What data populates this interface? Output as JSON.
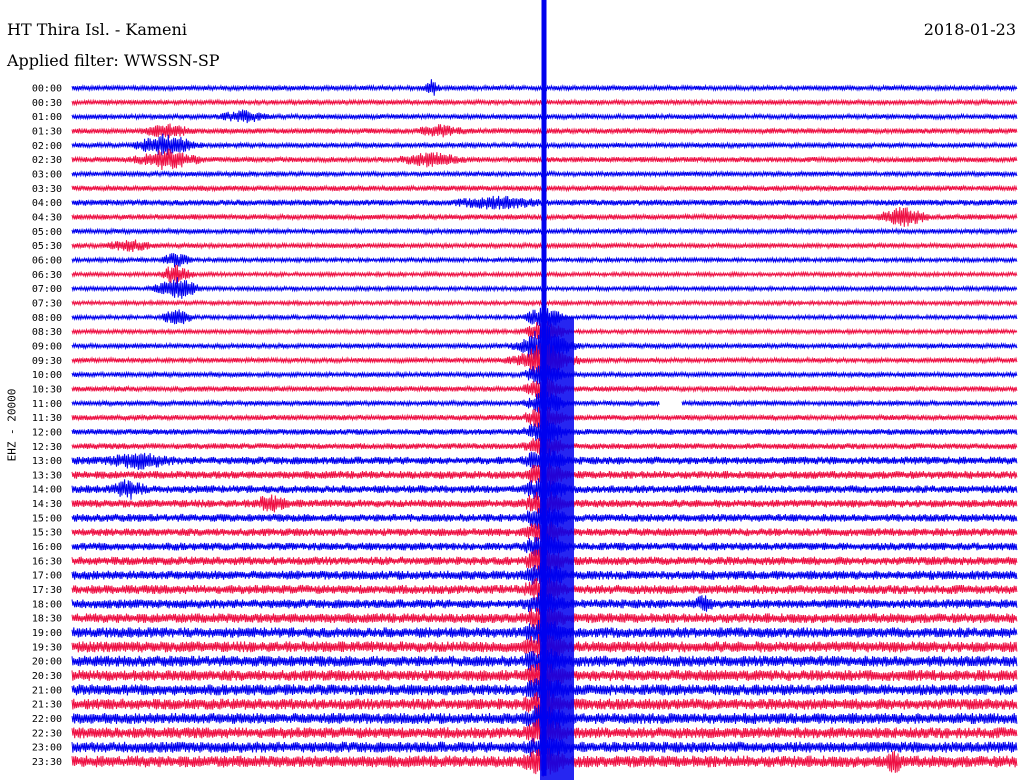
{
  "header": {
    "station": "HT Thira Isl. - Kameni",
    "filter": "Applied filter: WWSSN-SP",
    "date": "2018-01-23",
    "channel": "EHZ - 20000"
  },
  "chart_data": {
    "type": "line",
    "title": "HT Thira Isl. - Kameni",
    "subtitle": "Applied filter: WWSSN-SP",
    "date": "2018-01-23",
    "ylabel": "EHZ - 20000",
    "row_colors": [
      "#0000ee",
      "#ee1144"
    ],
    "rows": [
      {
        "label": "00:00",
        "noise": 0.35,
        "events": [
          {
            "x": 0.38,
            "amp": 1.2,
            "width": 0.01
          }
        ]
      },
      {
        "label": "00:30",
        "noise": 0.35,
        "events": []
      },
      {
        "label": "01:00",
        "noise": 0.35,
        "events": [
          {
            "x": 0.18,
            "amp": 0.8,
            "width": 0.03
          }
        ]
      },
      {
        "label": "01:30",
        "noise": 0.4,
        "events": [
          {
            "x": 0.1,
            "amp": 0.9,
            "width": 0.03
          },
          {
            "x": 0.39,
            "amp": 0.7,
            "width": 0.03
          }
        ]
      },
      {
        "label": "02:00",
        "noise": 0.35,
        "events": [
          {
            "x": 0.1,
            "amp": 1.6,
            "width": 0.04
          }
        ]
      },
      {
        "label": "02:30",
        "noise": 0.4,
        "events": [
          {
            "x": 0.1,
            "amp": 1.4,
            "width": 0.04
          },
          {
            "x": 0.38,
            "amp": 0.9,
            "width": 0.04
          }
        ]
      },
      {
        "label": "03:00",
        "noise": 0.35,
        "events": []
      },
      {
        "label": "03:30",
        "noise": 0.4,
        "events": []
      },
      {
        "label": "04:00",
        "noise": 0.45,
        "events": [
          {
            "x": 0.45,
            "amp": 0.8,
            "width": 0.05
          }
        ]
      },
      {
        "label": "04:30",
        "noise": 0.4,
        "events": [
          {
            "x": 0.88,
            "amp": 1.3,
            "width": 0.03
          }
        ]
      },
      {
        "label": "05:00",
        "noise": 0.35,
        "events": []
      },
      {
        "label": "05:30",
        "noise": 0.35,
        "events": [
          {
            "x": 0.06,
            "amp": 0.8,
            "width": 0.03
          }
        ]
      },
      {
        "label": "06:00",
        "noise": 0.3,
        "events": [
          {
            "x": 0.11,
            "amp": 1.0,
            "width": 0.02
          }
        ]
      },
      {
        "label": "06:30",
        "noise": 0.3,
        "events": [
          {
            "x": 0.11,
            "amp": 1.5,
            "width": 0.02
          }
        ]
      },
      {
        "label": "07:00",
        "noise": 0.3,
        "events": [
          {
            "x": 0.11,
            "amp": 1.6,
            "width": 0.03
          }
        ]
      },
      {
        "label": "07:30",
        "noise": 0.3,
        "events": []
      },
      {
        "label": "08:00",
        "noise": 0.3,
        "events": [
          {
            "x": 0.11,
            "amp": 1.2,
            "width": 0.02
          }
        ]
      },
      {
        "label": "08:30",
        "noise": 0.3,
        "events": []
      },
      {
        "label": "09:00",
        "noise": 0.35,
        "events": [
          {
            "x": 0.5,
            "amp": 1.6,
            "width": 0.04
          }
        ]
      },
      {
        "label": "09:30",
        "noise": 0.35,
        "events": [
          {
            "x": 0.5,
            "amp": 1.1,
            "width": 0.05
          }
        ]
      },
      {
        "label": "10:00",
        "noise": 0.35,
        "events": []
      },
      {
        "label": "10:30",
        "noise": 0.4,
        "events": []
      },
      {
        "label": "11:00",
        "noise": 0.35,
        "events": [],
        "gap": [
          0.622,
          0.646
        ]
      },
      {
        "label": "11:30",
        "noise": 0.4,
        "events": []
      },
      {
        "label": "12:00",
        "noise": 0.45,
        "events": []
      },
      {
        "label": "12:30",
        "noise": 0.45,
        "events": []
      },
      {
        "label": "13:00",
        "noise": 0.6,
        "events": [
          {
            "x": 0.07,
            "amp": 0.9,
            "width": 0.04
          }
        ]
      },
      {
        "label": "13:30",
        "noise": 0.6,
        "events": []
      },
      {
        "label": "14:00",
        "noise": 0.6,
        "events": [
          {
            "x": 0.06,
            "amp": 1.2,
            "width": 0.02
          }
        ]
      },
      {
        "label": "14:30",
        "noise": 0.6,
        "events": [
          {
            "x": 0.21,
            "amp": 1.0,
            "width": 0.02
          }
        ]
      },
      {
        "label": "15:00",
        "noise": 0.6,
        "events": []
      },
      {
        "label": "15:30",
        "noise": 0.6,
        "events": []
      },
      {
        "label": "16:00",
        "noise": 0.6,
        "events": []
      },
      {
        "label": "16:30",
        "noise": 0.65,
        "events": []
      },
      {
        "label": "17:00",
        "noise": 0.7,
        "events": []
      },
      {
        "label": "17:30",
        "noise": 0.7,
        "events": []
      },
      {
        "label": "18:00",
        "noise": 0.7,
        "events": [
          {
            "x": 0.67,
            "amp": 1.2,
            "width": 0.01
          }
        ]
      },
      {
        "label": "18:30",
        "noise": 0.75,
        "events": []
      },
      {
        "label": "19:00",
        "noise": 0.8,
        "events": []
      },
      {
        "label": "19:30",
        "noise": 0.85,
        "events": []
      },
      {
        "label": "20:00",
        "noise": 0.85,
        "events": []
      },
      {
        "label": "20:30",
        "noise": 0.85,
        "events": []
      },
      {
        "label": "21:00",
        "noise": 0.85,
        "events": []
      },
      {
        "label": "21:30",
        "noise": 0.85,
        "events": []
      },
      {
        "label": "22:00",
        "noise": 0.85,
        "events": []
      },
      {
        "label": "22:30",
        "noise": 0.85,
        "events": []
      },
      {
        "label": "23:00",
        "noise": 0.85,
        "events": []
      },
      {
        "label": "23:30",
        "noise": 0.9,
        "events": [
          {
            "x": 0.87,
            "amp": 1.2,
            "width": 0.01
          }
        ]
      }
    ],
    "global_event": {
      "x": 0.5,
      "onset_row": 16,
      "amp": 1.8
    }
  }
}
